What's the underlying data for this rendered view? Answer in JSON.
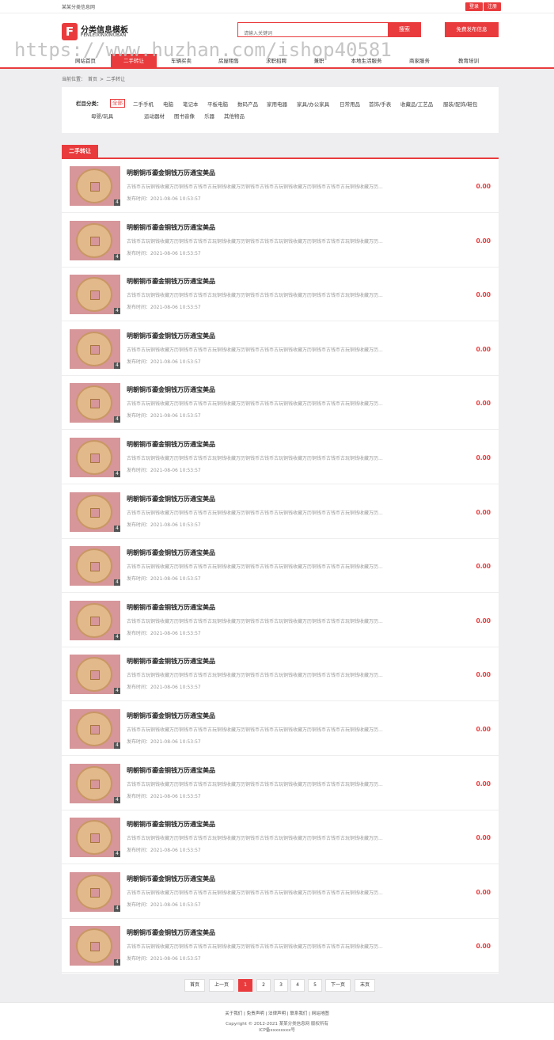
{
  "topbar": {
    "site_name": "某某分类信息网",
    "login": "登录",
    "register": "注册"
  },
  "header": {
    "logo_letter": "F",
    "logo_cn": "分类信息模板",
    "logo_en": "FENLEIXINXIMUBAN",
    "search_placeholder": "请输入关键词",
    "search_button": "搜索",
    "publish_button": "免费发布信息"
  },
  "watermark": "https://www.huzhan.com/ishop40581",
  "nav": [
    "网站首页",
    "二手转让",
    "车辆买卖",
    "房屋租售",
    "求职招聘",
    "兼职",
    "本地生活服务",
    "商家服务",
    "教育培训"
  ],
  "breadcrumb": {
    "label": "当前位置：",
    "home": "首页",
    "sep": ">",
    "current": "二手转让"
  },
  "filter": {
    "label": "栏目分类：",
    "options": [
      "全部",
      "二手手机",
      "电脑",
      "笔记本",
      "平板电脑",
      "数码产品",
      "家用电器",
      "家具/办公家具",
      "日常用品",
      "首饰/手表",
      "收藏品/工艺品",
      "服装/配饰/鞋包",
      "母婴/玩具",
      "运动器材",
      "图书音像",
      "乐器",
      "其他物品"
    ],
    "selected": "全部"
  },
  "section_title": "二手转让",
  "listings": [
    {
      "title": "明朝铜币鎏金铜钱万历通宝美品",
      "desc": "古钱币古玩铜钱收藏万历铜钱币古钱币古玩铜钱收藏万历铜钱币古钱币古玩铜钱收藏万历铜钱币古钱币古玩铜钱收藏万历...",
      "time": "发布时间：2021-08-06 10:53:57",
      "price": "0.00",
      "badge": "4"
    },
    {
      "title": "明朝铜币鎏金铜钱万历通宝美品",
      "desc": "古钱币古玩铜钱收藏万历铜钱币古钱币古玩铜钱收藏万历铜钱币古钱币古玩铜钱收藏万历铜钱币古钱币古玩铜钱收藏万历...",
      "time": "发布时间：2021-08-06 10:53:57",
      "price": "0.00",
      "badge": "4"
    },
    {
      "title": "明朝铜币鎏金铜钱万历通宝美品",
      "desc": "古钱币古玩铜钱收藏万历铜钱币古钱币古玩铜钱收藏万历铜钱币古钱币古玩铜钱收藏万历铜钱币古钱币古玩铜钱收藏万历...",
      "time": "发布时间：2021-08-06 10:53:57",
      "price": "0.00",
      "badge": "4"
    },
    {
      "title": "明朝铜币鎏金铜钱万历通宝美品",
      "desc": "古钱币古玩铜钱收藏万历铜钱币古钱币古玩铜钱收藏万历铜钱币古钱币古玩铜钱收藏万历铜钱币古钱币古玩铜钱收藏万历...",
      "time": "发布时间：2021-08-06 10:53:57",
      "price": "0.00",
      "badge": "4"
    },
    {
      "title": "明朝铜币鎏金铜钱万历通宝美品",
      "desc": "古钱币古玩铜钱收藏万历铜钱币古钱币古玩铜钱收藏万历铜钱币古钱币古玩铜钱收藏万历铜钱币古钱币古玩铜钱收藏万历...",
      "time": "发布时间：2021-08-06 10:53:57",
      "price": "0.00",
      "badge": "4"
    },
    {
      "title": "明朝铜币鎏金铜钱万历通宝美品",
      "desc": "古钱币古玩铜钱收藏万历铜钱币古钱币古玩铜钱收藏万历铜钱币古钱币古玩铜钱收藏万历铜钱币古钱币古玩铜钱收藏万历...",
      "time": "发布时间：2021-08-06 10:53:57",
      "price": "0.00",
      "badge": "4"
    },
    {
      "title": "明朝铜币鎏金铜钱万历通宝美品",
      "desc": "古钱币古玩铜钱收藏万历铜钱币古钱币古玩铜钱收藏万历铜钱币古钱币古玩铜钱收藏万历铜钱币古钱币古玩铜钱收藏万历...",
      "time": "发布时间：2021-08-06 10:53:57",
      "price": "0.00",
      "badge": "4"
    },
    {
      "title": "明朝铜币鎏金铜钱万历通宝美品",
      "desc": "古钱币古玩铜钱收藏万历铜钱币古钱币古玩铜钱收藏万历铜钱币古钱币古玩铜钱收藏万历铜钱币古钱币古玩铜钱收藏万历...",
      "time": "发布时间：2021-08-06 10:53:57",
      "price": "0.00",
      "badge": "4"
    },
    {
      "title": "明朝铜币鎏金铜钱万历通宝美品",
      "desc": "古钱币古玩铜钱收藏万历铜钱币古钱币古玩铜钱收藏万历铜钱币古钱币古玩铜钱收藏万历铜钱币古钱币古玩铜钱收藏万历...",
      "time": "发布时间：2021-08-06 10:53:57",
      "price": "0.00",
      "badge": "4"
    },
    {
      "title": "明朝铜币鎏金铜钱万历通宝美品",
      "desc": "古钱币古玩铜钱收藏万历铜钱币古钱币古玩铜钱收藏万历铜钱币古钱币古玩铜钱收藏万历铜钱币古钱币古玩铜钱收藏万历...",
      "time": "发布时间：2021-08-06 10:53:57",
      "price": "0.00",
      "badge": "4"
    },
    {
      "title": "明朝铜币鎏金铜钱万历通宝美品",
      "desc": "古钱币古玩铜钱收藏万历铜钱币古钱币古玩铜钱收藏万历铜钱币古钱币古玩铜钱收藏万历铜钱币古钱币古玩铜钱收藏万历...",
      "time": "发布时间：2021-08-06 10:53:57",
      "price": "0.00",
      "badge": "4"
    },
    {
      "title": "明朝铜币鎏金铜钱万历通宝美品",
      "desc": "古钱币古玩铜钱收藏万历铜钱币古钱币古玩铜钱收藏万历铜钱币古钱币古玩铜钱收藏万历铜钱币古钱币古玩铜钱收藏万历...",
      "time": "发布时间：2021-08-06 10:53:57",
      "price": "0.00",
      "badge": "4"
    },
    {
      "title": "明朝铜币鎏金铜钱万历通宝美品",
      "desc": "古钱币古玩铜钱收藏万历铜钱币古钱币古玩铜钱收藏万历铜钱币古钱币古玩铜钱收藏万历铜钱币古钱币古玩铜钱收藏万历...",
      "time": "发布时间：2021-08-06 10:53:57",
      "price": "0.00",
      "badge": "4"
    },
    {
      "title": "明朝铜币鎏金铜钱万历通宝美品",
      "desc": "古钱币古玩铜钱收藏万历铜钱币古钱币古玩铜钱收藏万历铜钱币古钱币古玩铜钱收藏万历铜钱币古钱币古玩铜钱收藏万历...",
      "time": "发布时间：2021-08-06 10:53:57",
      "price": "0.00",
      "badge": "4"
    },
    {
      "title": "明朝铜币鎏金铜钱万历通宝美品",
      "desc": "古钱币古玩铜钱收藏万历铜钱币古钱币古玩铜钱收藏万历铜钱币古钱币古玩铜钱收藏万历铜钱币古钱币古玩铜钱收藏万历...",
      "time": "发布时间：2021-08-06 10:53:57",
      "price": "0.00",
      "badge": "4"
    }
  ],
  "pagination": {
    "first": "首页",
    "prev": "上一页",
    "pages": [
      "1",
      "2",
      "3",
      "4",
      "5"
    ],
    "current": "1",
    "next": "下一页",
    "last": "末页"
  },
  "footer": {
    "links": "关于我们 | 免责声明 | 法律声明 | 联系我们 | 网站地图",
    "copyright": "Copyright © 2012-2021 某某分类信息网 版权所有",
    "icp": "ICP备xxxxxxxx号"
  },
  "colors": {
    "accent": "#e93b3d"
  }
}
